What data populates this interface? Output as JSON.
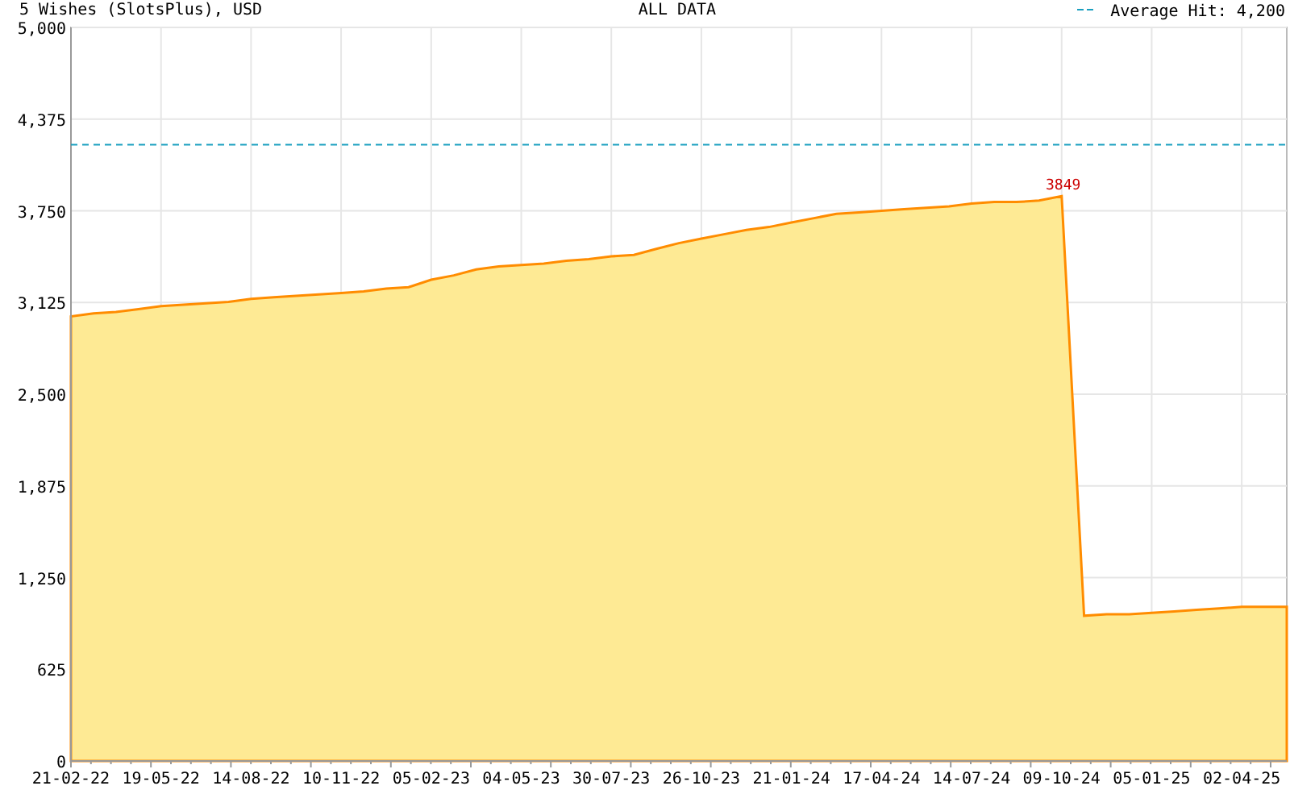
{
  "header": {
    "period": "ALL DATA"
  },
  "chart_data": {
    "type": "area",
    "title": "5 Wishes (SlotsPlus), USD",
    "categories": [
      "21-02-22",
      null,
      null,
      null,
      "19-05-22",
      null,
      null,
      null,
      "14-08-22",
      null,
      null,
      null,
      "10-11-22",
      null,
      null,
      null,
      "05-02-23",
      null,
      null,
      null,
      "04-05-23",
      null,
      null,
      null,
      "30-07-23",
      null,
      null,
      null,
      "26-10-23",
      null,
      null,
      null,
      "21-01-24",
      null,
      null,
      null,
      "17-04-24",
      null,
      null,
      null,
      "14-07-24",
      null,
      null,
      null,
      "09-10-24",
      null,
      null,
      null,
      "05-01-25",
      null,
      null,
      null,
      "02-04-25",
      null,
      null
    ],
    "series": [
      {
        "color": "#ff8c00",
        "values": [
          3030,
          3050,
          3060,
          3080,
          3100,
          3110,
          3120,
          3130,
          3150,
          3160,
          3170,
          3180,
          3190,
          3200,
          3220,
          3230,
          3280,
          3310,
          3350,
          3370,
          3380,
          3390,
          3410,
          3420,
          3440,
          3450,
          3490,
          3530,
          3560,
          3590,
          3620,
          3640,
          3670,
          3700,
          3730,
          3740,
          3750,
          3760,
          3770,
          3780,
          3800,
          3810,
          3810,
          3820,
          3849,
          990,
          1000,
          1000,
          1010,
          1020,
          1030,
          1040,
          1050,
          1050,
          1050
        ]
      }
    ],
    "ylim": [
      0,
      5000
    ],
    "grid": true,
    "yticks": [
      {
        "value": 0,
        "label": "0"
      },
      {
        "value": 625,
        "label": "625"
      },
      {
        "value": 1250,
        "label": "1,250"
      },
      {
        "value": 1875,
        "label": "1,875"
      },
      {
        "value": 2500,
        "label": "2,500"
      },
      {
        "value": 3125,
        "label": "3,125"
      },
      {
        "value": 3750,
        "label": "3,750"
      },
      {
        "value": 4375,
        "label": "4,375"
      },
      {
        "value": 5000,
        "label": "5,000"
      }
    ],
    "annotations": [
      {
        "x": "09-10-24",
        "y": 3849,
        "text": "3849"
      }
    ],
    "ref_lines": [
      {
        "axis": "y",
        "value": 4200,
        "label": "Average Hit: 4,200",
        "color": "#1a9fbf"
      }
    ]
  }
}
